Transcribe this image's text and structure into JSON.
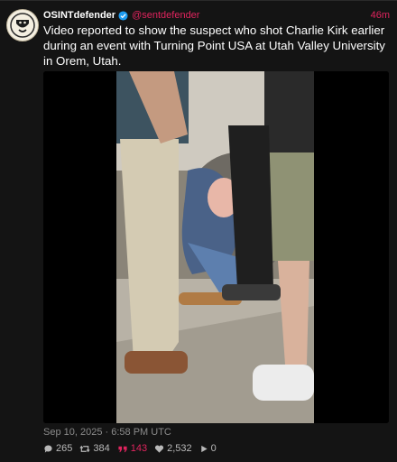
{
  "post": {
    "display_name": "OSINTdefender",
    "handle": "@sentdefender",
    "time_ago": "46m",
    "text": "Video reported to show the suspect who shot Charlie Kirk earlier during an event with Turning Point USA at Utah Valley University in Orem, Utah.",
    "date": "Sep 10, 2025 · 6:58 PM UTC"
  },
  "stats": {
    "replies": "265",
    "reposts": "384",
    "quotes": "143",
    "likes": "2,532",
    "views": "0"
  },
  "icons": [
    "avatar-logo-icon",
    "verified-icon",
    "reply-icon",
    "repost-icon",
    "quote-icon",
    "like-icon",
    "views-icon"
  ],
  "colors": {
    "accent": "#e0245e",
    "verified": "#1d9bf0",
    "background": "#141414"
  }
}
